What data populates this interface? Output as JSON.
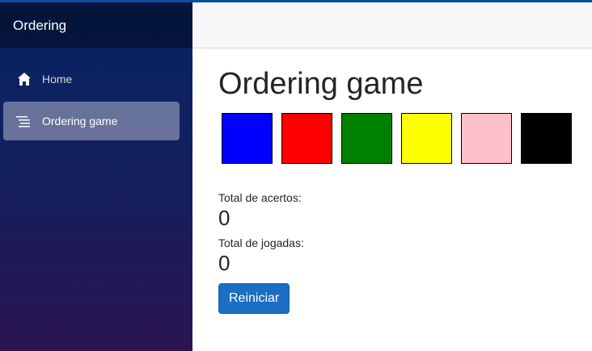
{
  "sidebar": {
    "brand": "Ordering",
    "items": [
      {
        "label": "Home",
        "icon": "home-icon",
        "active": false
      },
      {
        "label": "Ordering game",
        "icon": "list-icon",
        "active": true
      }
    ]
  },
  "main": {
    "title": "Ordering game",
    "swatches": [
      {
        "color": "#0000ff"
      },
      {
        "color": "#ff0000"
      },
      {
        "color": "#008000"
      },
      {
        "color": "#ffff00"
      },
      {
        "color": "#ffc0cb"
      },
      {
        "color": "#000000"
      }
    ],
    "hits_label": "Total de acertos:",
    "hits_value": "0",
    "plays_label": "Total de jogadas:",
    "plays_value": "0",
    "reset_label": "Reiniciar"
  },
  "colors": {
    "accent": "#1b6ec2",
    "sidebar_top": "#062466",
    "sidebar_bottom": "#2a1552"
  }
}
